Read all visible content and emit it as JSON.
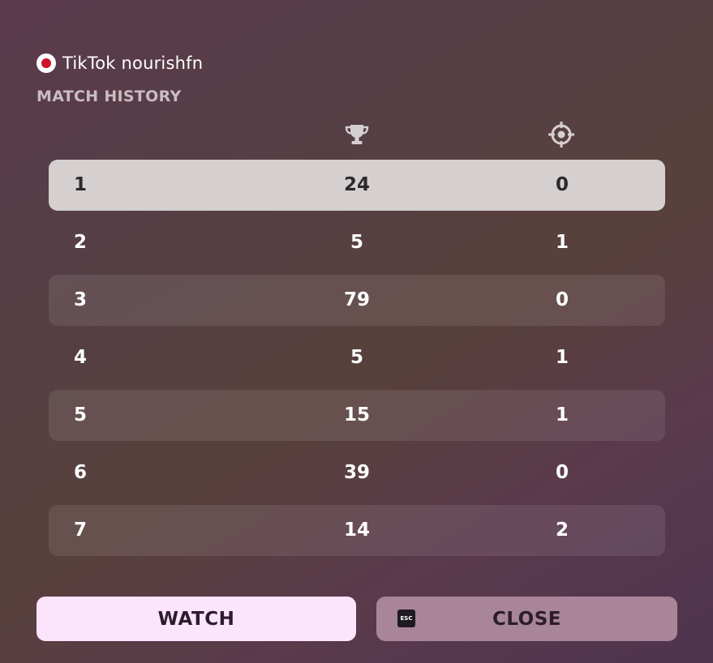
{
  "player": {
    "name": "TikTok nourishfn",
    "flag_colors": {
      "field": "#ffffff",
      "disc": "#d0112b"
    }
  },
  "section_title": "MATCH HISTORY",
  "columns": {
    "placement_icon": "trophy-icon",
    "eliminations_icon": "crosshair-icon"
  },
  "matches": [
    {
      "rank": "1",
      "placement": "24",
      "eliminations": "0",
      "selected": true
    },
    {
      "rank": "2",
      "placement": "5",
      "eliminations": "1",
      "selected": false
    },
    {
      "rank": "3",
      "placement": "79",
      "eliminations": "0",
      "selected": false
    },
    {
      "rank": "4",
      "placement": "5",
      "eliminations": "1",
      "selected": false
    },
    {
      "rank": "5",
      "placement": "15",
      "eliminations": "1",
      "selected": false
    },
    {
      "rank": "6",
      "placement": "39",
      "eliminations": "0",
      "selected": false
    },
    {
      "rank": "7",
      "placement": "14",
      "eliminations": "2",
      "selected": false
    }
  ],
  "buttons": {
    "watch_label": "WATCH",
    "close_label": "CLOSE",
    "close_key_label": "ESC"
  },
  "colors": {
    "selected_row": "#d5cfcf",
    "watch_button": "#fde4fd",
    "close_button": "#a88599"
  }
}
